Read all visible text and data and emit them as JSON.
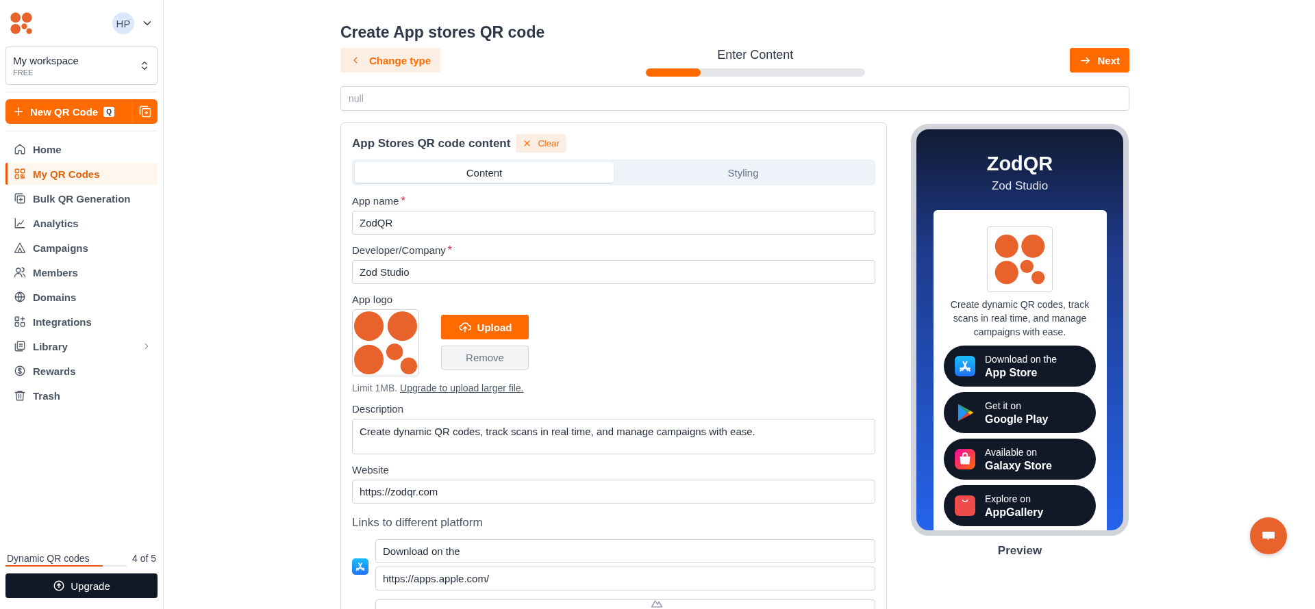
{
  "sidebar": {
    "avatar": "HP",
    "workspace": {
      "name": "My workspace",
      "plan": "FREE"
    },
    "new_button": {
      "label": "New QR Code",
      "shortcut": "Q"
    },
    "nav": [
      {
        "label": "Home",
        "selected": false,
        "expandable": false
      },
      {
        "label": "My QR Codes",
        "selected": true,
        "expandable": false
      },
      {
        "label": "Bulk QR Generation",
        "selected": false,
        "expandable": false
      },
      {
        "label": "Analytics",
        "selected": false,
        "expandable": false
      },
      {
        "label": "Campaigns",
        "selected": false,
        "expandable": false
      },
      {
        "label": "Members",
        "selected": false,
        "expandable": false
      },
      {
        "label": "Domains",
        "selected": false,
        "expandable": false
      },
      {
        "label": "Integrations",
        "selected": false,
        "expandable": false
      },
      {
        "label": "Library",
        "selected": false,
        "expandable": true
      },
      {
        "label": "Rewards",
        "selected": false,
        "expandable": false
      },
      {
        "label": "Trash",
        "selected": false,
        "expandable": false
      }
    ],
    "usage": {
      "label": "Dynamic QR codes",
      "count": "4 of 5",
      "level": 0.8
    },
    "upgrade_button": "Upgrade"
  },
  "header": {
    "title": "Create App stores QR code",
    "back_button": "Change type",
    "step": {
      "label": "Enter Content",
      "level": 0.25
    },
    "next_button": "Next"
  },
  "name_field": {
    "placeholder": "null"
  },
  "form": {
    "title": "App Stores QR code content",
    "clear_button": "Clear",
    "tabs": [
      {
        "label": "Content",
        "selected": true
      },
      {
        "label": "Styling",
        "selected": false
      }
    ],
    "fields": [
      {
        "label": "App name",
        "required_mark": "*",
        "value": "ZodQR"
      },
      {
        "label": "Developer/Company",
        "required_mark": "*",
        "value": "Zod Studio"
      }
    ],
    "logo": {
      "label": "App logo",
      "upload_button": "Upload",
      "remove_button": "Remove",
      "note": "Limit 1MB.",
      "note_link": "Upgrade to upload larger file."
    },
    "description": {
      "label": "Description",
      "value": "Create dynamic QR codes, track scans in real time, and manage campaigns with ease."
    },
    "website": {
      "label": "Website",
      "value": "https://zodqr.com"
    },
    "links": {
      "title": "Links to different platform",
      "platforms": [
        {
          "kind": "appstore",
          "text": "Download on the",
          "url": "https://apps.apple.com/"
        }
      ]
    }
  },
  "preview": {
    "title": "ZodQR",
    "subtitle": "Zod Studio",
    "description": "Create dynamic QR codes, track scans in real time, and manage campaigns with ease.",
    "stores": [
      {
        "kind": "appstore",
        "small": "Download on the",
        "big": "App Store"
      },
      {
        "kind": "googleplay",
        "small": "Get it on",
        "big": "Google Play"
      },
      {
        "kind": "galaxy",
        "small": "Available on",
        "big": "Galaxy Store"
      },
      {
        "kind": "appgallery",
        "small": "Explore on",
        "big": "AppGallery"
      }
    ],
    "caption": "Preview"
  }
}
